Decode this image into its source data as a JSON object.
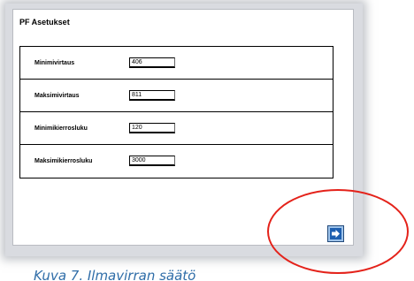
{
  "window": {
    "title": "PF Asetukset"
  },
  "settings": [
    {
      "label": "Minimivirtaus",
      "value": "406"
    },
    {
      "label": "Maksimivirtaus",
      "value": "811"
    },
    {
      "label": "Minimikierrosluku",
      "value": "120"
    },
    {
      "label": "Maksimikierrosluku",
      "value": "3000"
    }
  ],
  "navigation": {
    "next_icon": "arrow-right-icon"
  },
  "annotation": {
    "highlight_color": "#e4221a"
  },
  "caption": "Kuva 7. Ilmavirran säätö"
}
